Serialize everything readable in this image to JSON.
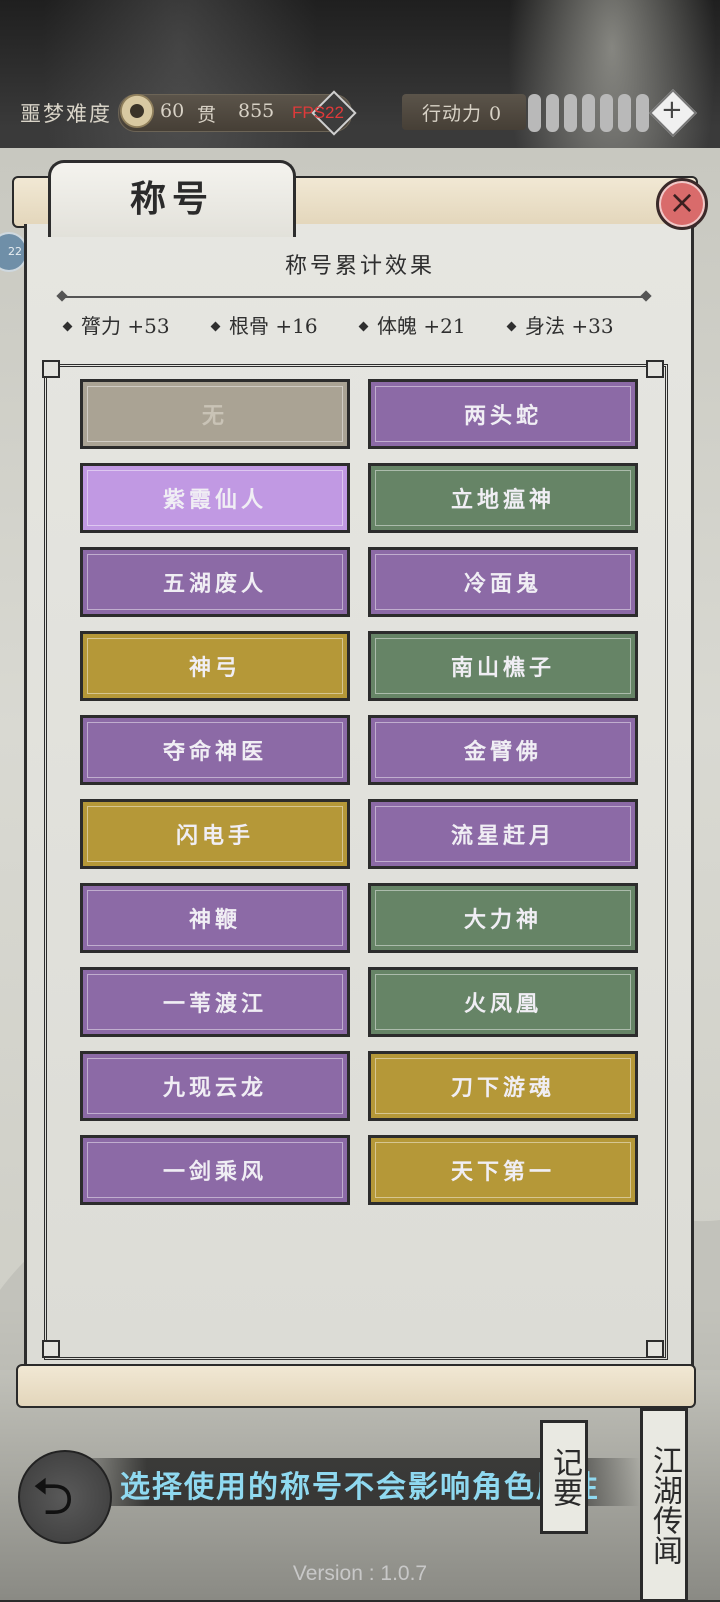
{
  "header": {
    "difficulty": "噩梦难度",
    "coins": "60",
    "currency_label": "贯",
    "currency_value": "855",
    "fps": "FPS22",
    "action_label": "行动力 0",
    "plus": "+"
  },
  "left_badge": "22",
  "panel": {
    "tab_title": "称号",
    "close": "×",
    "effect_title": "称号累计效果",
    "stats": [
      "膂力 +53",
      "根骨 +16",
      "体魄 +21",
      "身法 +33"
    ]
  },
  "titles": [
    {
      "label": "无",
      "color": "grey"
    },
    {
      "label": "两头蛇",
      "color": "purple"
    },
    {
      "label": "紫霞仙人",
      "color": "lilac"
    },
    {
      "label": "立地瘟神",
      "color": "green"
    },
    {
      "label": "五湖废人",
      "color": "purple"
    },
    {
      "label": "冷面鬼",
      "color": "purple"
    },
    {
      "label": "神弓",
      "color": "gold"
    },
    {
      "label": "南山樵子",
      "color": "green"
    },
    {
      "label": "夺命神医",
      "color": "purple"
    },
    {
      "label": "金臂佛",
      "color": "purple"
    },
    {
      "label": "闪电手",
      "color": "gold"
    },
    {
      "label": "流星赶月",
      "color": "purple"
    },
    {
      "label": "神鞭",
      "color": "purple"
    },
    {
      "label": "大力神",
      "color": "green"
    },
    {
      "label": "一苇渡江",
      "color": "purple"
    },
    {
      "label": "火凤凰",
      "color": "green"
    },
    {
      "label": "九现云龙",
      "color": "purple"
    },
    {
      "label": "刀下游魂",
      "color": "gold"
    },
    {
      "label": "一剑乘风",
      "color": "purple"
    },
    {
      "label": "天下第一",
      "color": "gold"
    }
  ],
  "colors": {
    "purple": "#8c6aa6",
    "green": "#668466",
    "gold": "#b59838",
    "grey": "#aaa394",
    "lilac": "#c199e3",
    "hint_text": "#8fd9f0"
  },
  "footer": {
    "hint": "选择使用的称号不会影响角色属性",
    "notes_card": "记要",
    "legend_card": "江湖传闻",
    "version": "Version : 1.0.7"
  }
}
